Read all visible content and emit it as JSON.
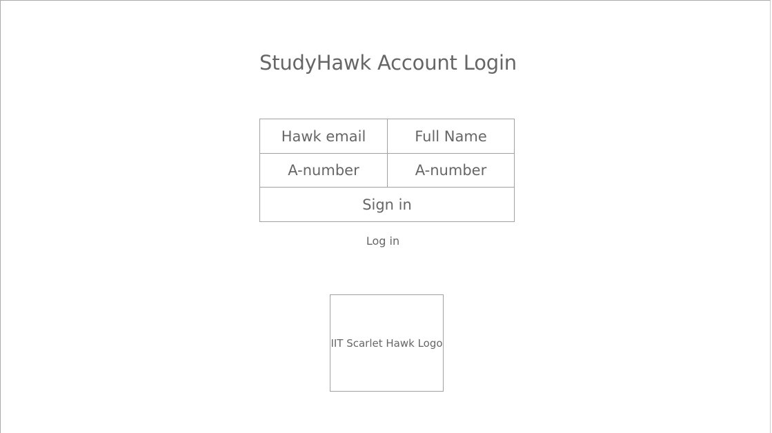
{
  "header": {
    "title": "StudyHawk Account Login"
  },
  "form": {
    "hawk_email": "Hawk email",
    "full_name": "Full Name",
    "a_number_left": "A-number",
    "a_number_right": "A-number",
    "sign_in": "Sign in"
  },
  "links": {
    "log_in": "Log in"
  },
  "logo": {
    "label": "IIT Scarlet Hawk Logo"
  },
  "colors": {
    "text": "#666666",
    "border": "#a0a0a0",
    "background": "#ffffff"
  }
}
